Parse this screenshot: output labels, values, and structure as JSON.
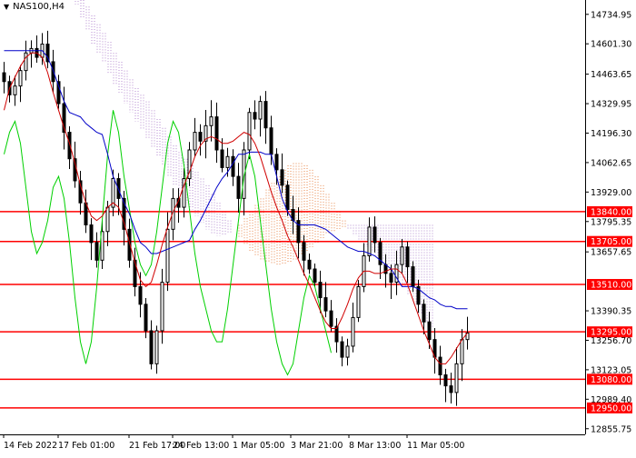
{
  "colors": {
    "background": "#ffffff",
    "candle": "#000000",
    "level_line": "#ff0000",
    "level_label_bg": "#ff0000",
    "level_label_text": "#ffffff",
    "kijun": "#0000c8",
    "tenkan": "#d00000",
    "chikou": "#00d000",
    "cloud_bullish": "#e8864a",
    "cloud_bearish": "#b48ad0",
    "axis": "#000000"
  },
  "chart_data": {
    "type": "candlestick",
    "symbol_label": "NAS100,H4",
    "y_ticks": [
      14734.95,
      14601.3,
      14463.65,
      14329.95,
      14196.3,
      14062.65,
      13929.0,
      13795.35,
      13657.65,
      13390.35,
      13256.7,
      13123.05,
      12989.4,
      12855.75
    ],
    "ylim": [
      12830,
      14800
    ],
    "x_labels": [
      "14 Feb 2022",
      "17 Feb 01:00",
      "21 Feb 17:00",
      "24 Feb 13:00",
      "1 Mar 05:00",
      "3 Mar 21:00",
      "8 Mar 13:00",
      "11 Mar 05:00"
    ],
    "horizontal_levels": [
      13840.0,
      13705.0,
      13510.0,
      13295.0,
      13080.0,
      12950.0
    ],
    "price_series": [
      14430,
      14370,
      14410,
      14480,
      14560,
      14580,
      14540,
      14600,
      14520,
      14430,
      14330,
      14200,
      14080,
      13980,
      13880,
      13780,
      13700,
      13620,
      13750,
      13860,
      13990,
      13900,
      13760,
      13620,
      13500,
      13420,
      13300,
      13150,
      13300,
      13520,
      13760,
      13900,
      13860,
      13990,
      14120,
      14200,
      14160,
      14230,
      14270,
      14120,
      14040,
      14090,
      14000,
      13900,
      14120,
      14290,
      14260,
      14340,
      14220,
      14100,
      14030,
      13960,
      13850,
      13800,
      13700,
      13620,
      13580,
      13520,
      13450,
      13390,
      13320,
      13250,
      13180,
      13230,
      13360,
      13500,
      13640,
      13770,
      13700,
      13600,
      13560,
      13520,
      13600,
      13680,
      13590,
      13500,
      13420,
      13340,
      13260,
      13180,
      13100,
      13050,
      13020,
      13150,
      13260,
      13290
    ],
    "tenkan": [
      14300,
      14400,
      14450,
      14500,
      14540,
      14560,
      14560,
      14540,
      14470,
      14380,
      14300,
      14220,
      14150,
      14060,
      13960,
      13880,
      13820,
      13800,
      13820,
      13860,
      13880,
      13860,
      13790,
      13700,
      13610,
      13530,
      13500,
      13520,
      13600,
      13690,
      13770,
      13840,
      13890,
      13960,
      14020,
      14090,
      14140,
      14170,
      14180,
      14170,
      14150,
      14150,
      14160,
      14180,
      14200,
      14190,
      14150,
      14090,
      14010,
      13930,
      13860,
      13800,
      13730,
      13680,
      13620,
      13560,
      13510,
      13450,
      13390,
      13340,
      13310,
      13310,
      13360,
      13420,
      13490,
      13540,
      13570,
      13570,
      13560,
      13560,
      13570,
      13580,
      13580,
      13560,
      13510,
      13440,
      13370,
      13300,
      13240,
      13180,
      13150,
      13150,
      13180,
      13220,
      13260,
      13290
    ],
    "kijun": [
      14570,
      14570,
      14570,
      14570,
      14570,
      14570,
      14570,
      14570,
      14540,
      14480,
      14410,
      14340,
      14290,
      14280,
      14270,
      14240,
      14220,
      14200,
      14190,
      14100,
      14000,
      13940,
      13880,
      13830,
      13760,
      13700,
      13680,
      13650,
      13650,
      13660,
      13670,
      13680,
      13690,
      13700,
      13710,
      13760,
      13800,
      13850,
      13900,
      13950,
      13990,
      14020,
      14060,
      14100,
      14100,
      14110,
      14110,
      14110,
      14100,
      14100,
      14000,
      13900,
      13840,
      13800,
      13780,
      13780,
      13780,
      13780,
      13770,
      13760,
      13740,
      13720,
      13700,
      13680,
      13670,
      13660,
      13660,
      13650,
      13640,
      13620,
      13600,
      13580,
      13540,
      13500,
      13500,
      13500,
      13490,
      13470,
      13450,
      13440,
      13420,
      13410,
      13410,
      13400,
      13400,
      13400
    ],
    "chikou": [
      14100,
      14200,
      14250,
      14150,
      13950,
      13750,
      13650,
      13700,
      13800,
      13950,
      14000,
      13900,
      13700,
      13450,
      13250,
      13150,
      13250,
      13500,
      13800,
      14100,
      14300,
      14200,
      14000,
      13850,
      13700,
      13600,
      13550,
      13600,
      13750,
      13950,
      14150,
      14250,
      14200,
      14050,
      13850,
      13650,
      13500,
      13400,
      13300,
      13250,
      13250,
      13400,
      13600,
      13800,
      14000,
      14100,
      14000,
      13800,
      13600,
      13400,
      13250,
      13150,
      13100,
      13150,
      13300,
      13450,
      13550,
      13500,
      13400,
      13300,
      13200
    ],
    "cloud_span_a": [
      14780,
      14720,
      14660,
      14600,
      14560,
      14520,
      14470,
      14420,
      14380,
      14330,
      14290,
      14250,
      14210,
      14170,
      14130,
      14090,
      14050,
      14000,
      13960,
      13920,
      13880,
      13850,
      13820,
      13790,
      13760,
      13740,
      13730,
      13730,
      13740,
      13760,
      13780,
      13810,
      13840,
      13870,
      13900,
      13940,
      13970,
      14000,
      14030,
      14050,
      14060,
      14060,
      14050,
      14030,
      14000,
      13960,
      13920,
      13880,
      13840,
      13800,
      13760,
      13730,
      13700,
      13680,
      13660,
      13640,
      13620,
      13600,
      13570,
      13540,
      13500,
      13460,
      13420,
      13380,
      13340,
      13310
    ],
    "cloud_span_b": [
      14820,
      14800,
      14770,
      14730,
      14690,
      14650,
      14610,
      14560,
      14520,
      14480,
      14440,
      14400,
      14370,
      14340,
      14300,
      14260,
      14220,
      14180,
      14140,
      14110,
      14080,
      14050,
      14020,
      13990,
      13960,
      13920,
      13880,
      13840,
      13800,
      13760,
      13720,
      13690,
      13660,
      13640,
      13620,
      13610,
      13600,
      13600,
      13600,
      13610,
      13620,
      13640,
      13660,
      13680,
      13700,
      13720,
      13740,
      13750,
      13760,
      13770,
      13780,
      13780,
      13780,
      13780,
      13780,
      13780,
      13780,
      13780,
      13780,
      13780,
      13780,
      13780,
      13780,
      13780,
      13780,
      13780
    ],
    "grid": false,
    "legend": "none"
  }
}
